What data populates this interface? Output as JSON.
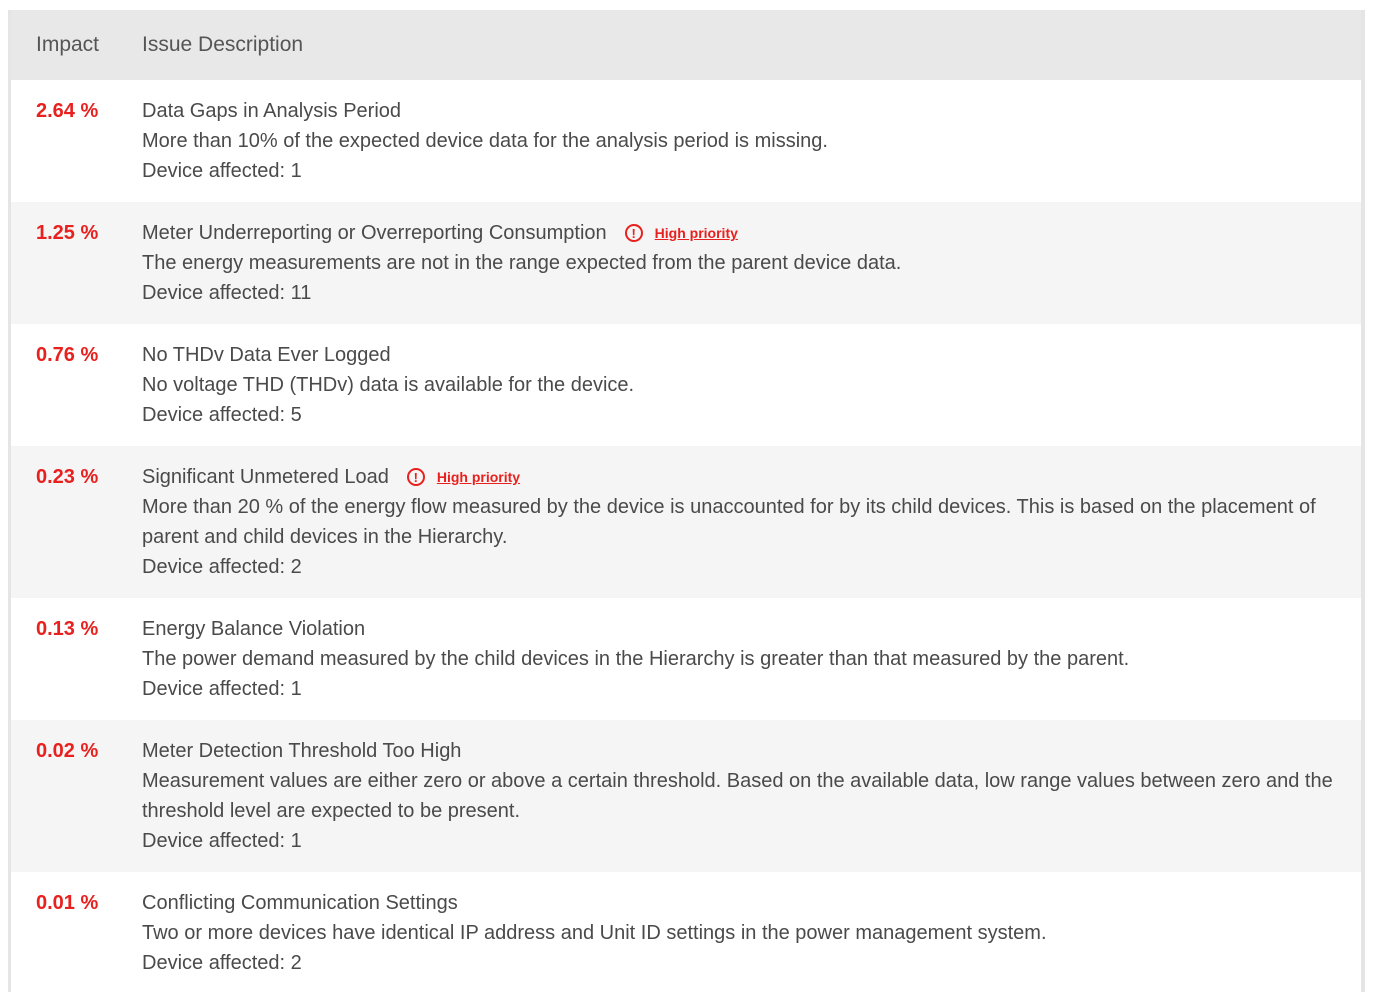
{
  "header": {
    "impact": "Impact",
    "description": "Issue Description"
  },
  "issues": [
    {
      "impact": "2.64 %",
      "title": "Data Gaps in Analysis Period",
      "description": "More than 10% of the expected device data for the analysis period is missing.",
      "affected": "Device affected: 1"
    },
    {
      "impact": "1.25 %",
      "title": "Meter Underreporting or Overreporting Consumption",
      "priority": "High priority",
      "description": "The energy measurements are not in the range expected from the parent device data.",
      "affected": "Device affected: 11"
    },
    {
      "impact": "0.76 %",
      "title": "No THDv Data Ever Logged",
      "description": "No voltage THD (THDv) data is available for the device.",
      "affected": "Device affected: 5"
    },
    {
      "impact": "0.23 %",
      "title": "Significant Unmetered Load",
      "priority": "High priority",
      "description": "More than 20 % of the energy flow measured by the device is unaccounted for by its child devices. This is based on the placement of parent and child devices in the Hierarchy.",
      "affected": "Device affected: 2"
    },
    {
      "impact": "0.13 %",
      "title": "Energy Balance Violation",
      "description": "The power demand measured by the child devices in the Hierarchy is greater than that measured by the parent.",
      "affected": "Device affected: 1"
    },
    {
      "impact": "0.02 %",
      "title": "Meter Detection Threshold Too High",
      "description": "Measurement values are either zero or above a certain threshold. Based on the available data, low range values between zero and the threshold level are expected to be present.",
      "affected": "Device affected: 1"
    },
    {
      "impact": "0.01 %",
      "title": "Conflicting Communication Settings",
      "description": "Two or more devices have identical IP address and Unit ID settings in the power management system.",
      "affected": "Device affected: 2"
    }
  ],
  "colors": {
    "impact": "#e8201e",
    "priority": "#e8201e",
    "header_bg": "#e8e8e8",
    "row_odd": "#ffffff",
    "row_even": "#f5f5f5"
  },
  "icons": {
    "priority": "exclamation-circle-icon"
  }
}
